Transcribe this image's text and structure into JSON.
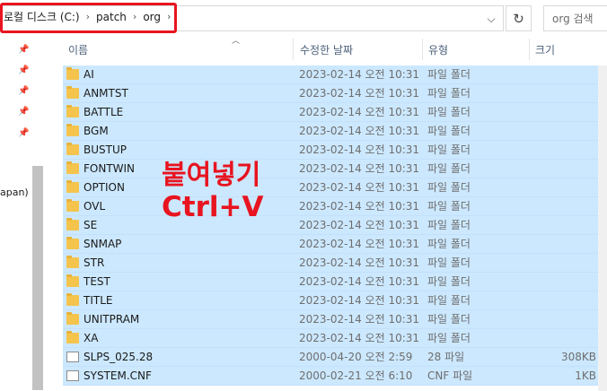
{
  "address": {
    "crumbs": [
      "로컬 디스크 (C:)",
      "patch",
      "org"
    ],
    "separator": "›",
    "dropdown_icon": "⌵",
    "refresh_icon": "↻",
    "search_placeholder": "org 검색"
  },
  "nav": {
    "partial_label": "apan) ("
  },
  "columns": {
    "name": "이름",
    "date": "수정한 날짜",
    "type": "유형",
    "size": "크기"
  },
  "files": [
    {
      "name": "AI",
      "date": "2023-02-14 오전 10:31",
      "type": "파일 폴더",
      "size": "",
      "kind": "folder"
    },
    {
      "name": "ANMTST",
      "date": "2023-02-14 오전 10:31",
      "type": "파일 폴더",
      "size": "",
      "kind": "folder"
    },
    {
      "name": "BATTLE",
      "date": "2023-02-14 오전 10:31",
      "type": "파일 폴더",
      "size": "",
      "kind": "folder"
    },
    {
      "name": "BGM",
      "date": "2023-02-14 오전 10:31",
      "type": "파일 폴더",
      "size": "",
      "kind": "folder"
    },
    {
      "name": "BUSTUP",
      "date": "2023-02-14 오전 10:31",
      "type": "파일 폴더",
      "size": "",
      "kind": "folder"
    },
    {
      "name": "FONTWIN",
      "date": "2023-02-14 오전 10:31",
      "type": "파일 폴더",
      "size": "",
      "kind": "folder"
    },
    {
      "name": "OPTION",
      "date": "2023-02-14 오전 10:31",
      "type": "파일 폴더",
      "size": "",
      "kind": "folder"
    },
    {
      "name": "OVL",
      "date": "2023-02-14 오전 10:31",
      "type": "파일 폴더",
      "size": "",
      "kind": "folder"
    },
    {
      "name": "SE",
      "date": "2023-02-14 오전 10:31",
      "type": "파일 폴더",
      "size": "",
      "kind": "folder"
    },
    {
      "name": "SNMAP",
      "date": "2023-02-14 오전 10:31",
      "type": "파일 폴더",
      "size": "",
      "kind": "folder"
    },
    {
      "name": "STR",
      "date": "2023-02-14 오전 10:31",
      "type": "파일 폴더",
      "size": "",
      "kind": "folder"
    },
    {
      "name": "TEST",
      "date": "2023-02-14 오전 10:31",
      "type": "파일 폴더",
      "size": "",
      "kind": "folder"
    },
    {
      "name": "TITLE",
      "date": "2023-02-14 오전 10:31",
      "type": "파일 폴더",
      "size": "",
      "kind": "folder"
    },
    {
      "name": "UNITPRAM",
      "date": "2023-02-14 오전 10:31",
      "type": "파일 폴더",
      "size": "",
      "kind": "folder"
    },
    {
      "name": "XA",
      "date": "2023-02-14 오전 10:31",
      "type": "파일 폴더",
      "size": "",
      "kind": "folder"
    },
    {
      "name": "SLPS_025.28",
      "date": "2000-04-20 오전 2:59",
      "type": "28 파일",
      "size": "308KB",
      "kind": "file"
    },
    {
      "name": "SYSTEM.CNF",
      "date": "2000-02-21 오전 6:10",
      "type": "CNF 파일",
      "size": "1KB",
      "kind": "file"
    }
  ],
  "overlay": {
    "line1": "붙여넣기",
    "line2": "Ctrl+V"
  },
  "colors": {
    "selection": "#cce8ff",
    "annotation_red": "#e8141f",
    "folder": "#f4c44d"
  }
}
